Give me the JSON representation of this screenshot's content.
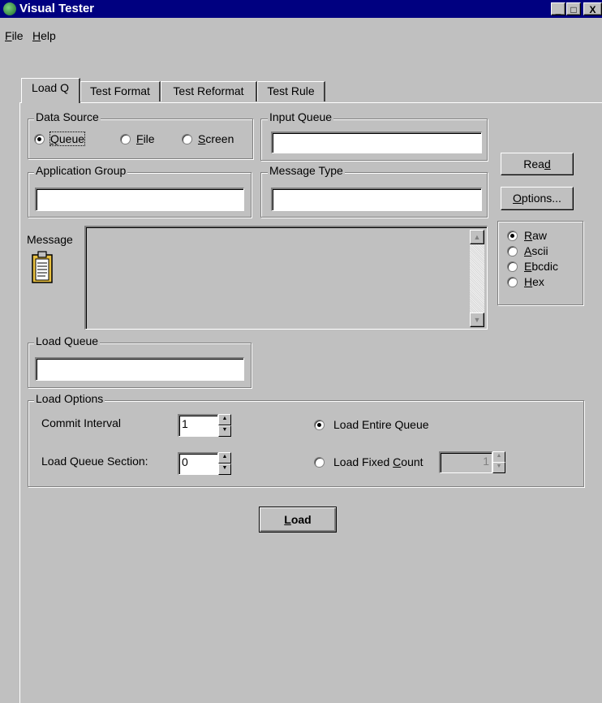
{
  "window": {
    "title": "Visual Tester",
    "buttons": {
      "minimize": "_",
      "maximize": "□",
      "close": "X"
    }
  },
  "menu": [
    {
      "label": "File",
      "mnemonic": "F",
      "rest": "ile"
    },
    {
      "label": "Help",
      "mnemonic": "H",
      "rest": "elp"
    }
  ],
  "tabs": [
    "Load Q",
    "Test Format",
    "Test Reformat",
    "Test Rule"
  ],
  "data_source": {
    "legend": "Data Source",
    "options": [
      {
        "label": "Queue",
        "mnemonic": "Q",
        "rest": "ueue",
        "checked": true
      },
      {
        "label": "File",
        "mnemonic": "F",
        "rest": "ile",
        "checked": false
      },
      {
        "label": "Screen",
        "mnemonic": "S",
        "rest": "creen",
        "checked": false
      }
    ]
  },
  "input_queue": {
    "legend": "Input Queue",
    "value": ""
  },
  "application_group": {
    "legend": "Application Group",
    "value": ""
  },
  "message_type": {
    "legend": "Message Type",
    "value": ""
  },
  "read_button": {
    "pre": "Rea",
    "mnemonic": "d",
    "post": ""
  },
  "options_button": {
    "pre": "",
    "mnemonic": "O",
    "post": "ptions..."
  },
  "message": {
    "label": "Message",
    "value": ""
  },
  "format_options": [
    {
      "label": "Raw",
      "mnemonic": "R",
      "rest": "aw",
      "checked": true
    },
    {
      "label": "Ascii",
      "mnemonic": "A",
      "rest": "scii",
      "checked": false
    },
    {
      "label": "Ebcdic",
      "mnemonic": "E",
      "rest": "bcdic",
      "checked": false
    },
    {
      "label": "Hex",
      "mnemonic": "H",
      "rest": "ex",
      "checked": false
    }
  ],
  "load_queue": {
    "legend": "Load Queue",
    "value": ""
  },
  "load_options": {
    "legend": "Load Options",
    "commit_interval_label": "Commit Interval",
    "commit_interval_value": "1",
    "load_queue_section_label": "Load Queue Section:",
    "load_queue_section_value": "0",
    "load_entire_queue": {
      "label": "Load Entire Queue",
      "checked": true
    },
    "load_fixed_count": {
      "pre": "Load Fixed ",
      "mnemonic": "C",
      "post": "ount",
      "checked": false,
      "value": "1"
    }
  },
  "load_button": {
    "pre": "",
    "mnemonic": "L",
    "post": "oad"
  }
}
